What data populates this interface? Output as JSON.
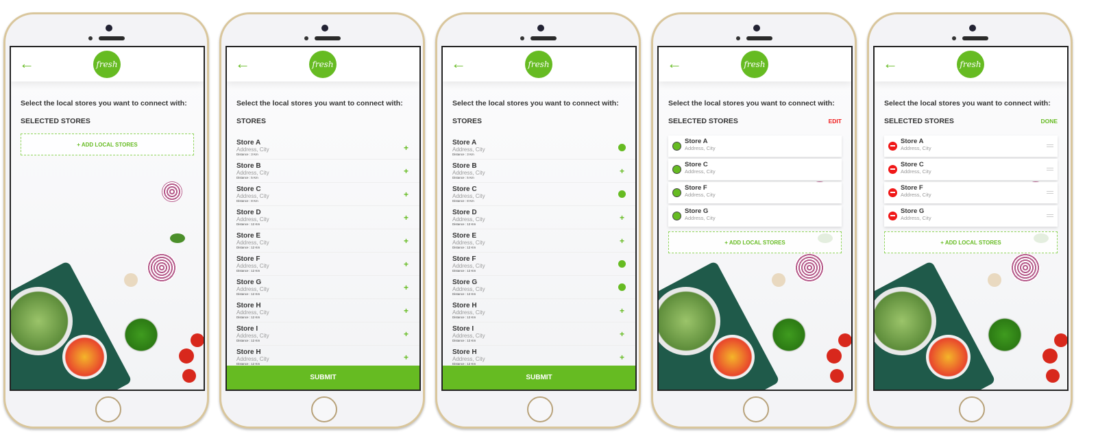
{
  "common": {
    "back_icon": "arrow-left-icon",
    "logo_text": "fresh",
    "prompt": "Select the local stores you want to connect with:",
    "add_label": "+ ADD LOCAL STORES",
    "submit_label": "SUBMIT",
    "colors": {
      "accent": "#66bb22",
      "danger": "#f01818"
    }
  },
  "screen1": {
    "section": "SELECTED STORES"
  },
  "screen2": {
    "section": "STORES",
    "stores": [
      {
        "name": "Store A",
        "address": "Address, City",
        "distance": "Distance : 3 Km",
        "selected": false
      },
      {
        "name": "Store B",
        "address": "Address, City",
        "distance": "Distance : 5 Km",
        "selected": false
      },
      {
        "name": "Store C",
        "address": "Address, City",
        "distance": "Distance : 8 Km",
        "selected": false
      },
      {
        "name": "Store D",
        "address": "Address, City",
        "distance": "Distance : 12 Km",
        "selected": false
      },
      {
        "name": "Store E",
        "address": "Address, City",
        "distance": "Distance : 12 Km",
        "selected": false
      },
      {
        "name": "Store F",
        "address": "Address, City",
        "distance": "Distance : 12 Km",
        "selected": false
      },
      {
        "name": "Store G",
        "address": "Address, City",
        "distance": "Distance : 12 Km",
        "selected": false
      },
      {
        "name": "Store H",
        "address": "Address, City",
        "distance": "Distance : 12 Km",
        "selected": false
      },
      {
        "name": "Store I",
        "address": "Address, City",
        "distance": "Distance : 12 Km",
        "selected": false
      },
      {
        "name": "Store H",
        "address": "Address, City",
        "distance": "Distance : 12 Km",
        "selected": false
      }
    ]
  },
  "screen3": {
    "section": "STORES",
    "stores": [
      {
        "name": "Store A",
        "address": "Address, City",
        "distance": "Distance : 3 Km",
        "selected": true
      },
      {
        "name": "Store B",
        "address": "Address, City",
        "distance": "Distance : 5 Km",
        "selected": false
      },
      {
        "name": "Store C",
        "address": "Address, City",
        "distance": "Distance : 8 Km",
        "selected": true
      },
      {
        "name": "Store D",
        "address": "Address, City",
        "distance": "Distance : 12 Km",
        "selected": false
      },
      {
        "name": "Store E",
        "address": "Address, City",
        "distance": "Distance : 12 Km",
        "selected": false
      },
      {
        "name": "Store F",
        "address": "Address, City",
        "distance": "Distance : 12 Km",
        "selected": true
      },
      {
        "name": "Store G",
        "address": "Address, City",
        "distance": "Distance : 12 Km",
        "selected": true
      },
      {
        "name": "Store H",
        "address": "Address, City",
        "distance": "Distance : 12 Km",
        "selected": false
      },
      {
        "name": "Store I",
        "address": "Address, City",
        "distance": "Distance : 12 Km",
        "selected": false
      },
      {
        "name": "Store H",
        "address": "Address, City",
        "distance": "Distance : 12 Km",
        "selected": false
      }
    ]
  },
  "screen4": {
    "section": "SELECTED STORES",
    "action": "EDIT",
    "stores": [
      {
        "name": "Store A",
        "address": "Address, City"
      },
      {
        "name": "Store C",
        "address": "Address, City"
      },
      {
        "name": "Store F",
        "address": "Address, City"
      },
      {
        "name": "Store G",
        "address": "Address, City"
      }
    ]
  },
  "screen5": {
    "section": "SELECTED STORES",
    "action": "DONE",
    "stores": [
      {
        "name": "Store A",
        "address": "Address, City"
      },
      {
        "name": "Store C",
        "address": "Address, City"
      },
      {
        "name": "Store F",
        "address": "Address, City"
      },
      {
        "name": "Store G",
        "address": "Address, City"
      }
    ]
  }
}
